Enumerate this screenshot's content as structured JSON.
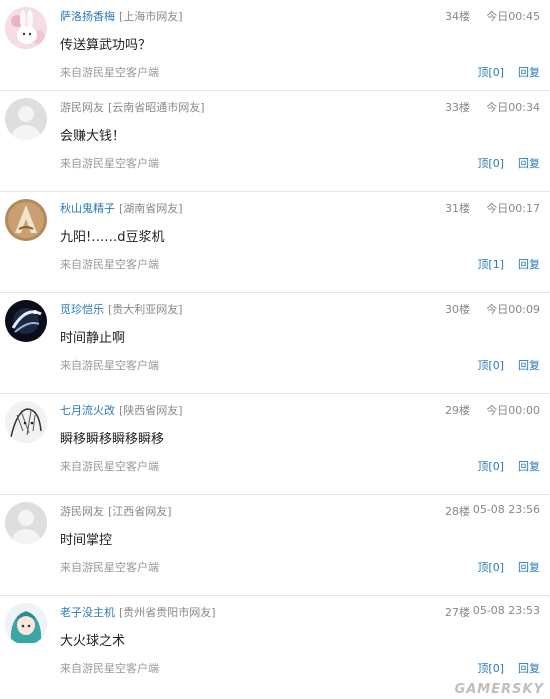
{
  "comments": [
    {
      "user": "萨洛扬香梅",
      "location": "[上海市网友]",
      "floor": "34楼",
      "time": "今日00:45",
      "content": "传送算武功吗？",
      "source": "来自游民星空客户端",
      "like": "顶[0]",
      "reply": "回复",
      "avatar": "rabbit-avatar-icon",
      "guest": false
    },
    {
      "user": "游民网友",
      "location": "[云南省昭通市网友]",
      "floor": "33楼",
      "time": "今日00:34",
      "content": "会赚大钱！",
      "source": "来自游民星空客户端",
      "like": "顶[0]",
      "reply": "回复",
      "avatar": "default-user-avatar-icon",
      "guest": true
    },
    {
      "user": "秋山鬼精子",
      "location": "[湖南省网友]",
      "floor": "31楼",
      "time": "今日00:17",
      "content": "九阳!……d豆浆机",
      "source": "来自游民星空客户端",
      "like": "顶[1]",
      "reply": "回复",
      "avatar": "assassin-emblem-avatar-icon",
      "guest": false
    },
    {
      "user": "觅珍恺乐",
      "location": "[贵大利亚网友]",
      "floor": "30楼",
      "time": "今日00:09",
      "content": "时间静止啊",
      "source": "来自游民星空客户端",
      "like": "顶[0]",
      "reply": "回复",
      "avatar": "space-orb-avatar-icon",
      "guest": false
    },
    {
      "user": "七月流火改",
      "location": "[陕西省网友]",
      "floor": "29楼",
      "time": "今日00:00",
      "content": "瞬移瞬移瞬移瞬移",
      "source": "来自游民星空客户端",
      "like": "顶[0]",
      "reply": "回复",
      "avatar": "sketch-character-avatar-icon",
      "guest": false
    },
    {
      "user": "游民网友",
      "location": "[江西省网友]",
      "floor": "28楼",
      "time": "05-08 23:56",
      "content": "时间掌控",
      "source": "来自游民星空客户端",
      "like": "顶[0]",
      "reply": "回复",
      "avatar": "default-user-avatar-icon",
      "guest": true
    },
    {
      "user": "老子没主机",
      "location": "[贵州省贵阳市网友]",
      "floor": "27楼",
      "time": "05-08 23:53",
      "content": "大火球之术",
      "source": "来自游民星空客户端",
      "like": "顶[0]",
      "reply": "回复",
      "avatar": "anime-girl-avatar-icon",
      "guest": false
    }
  ],
  "watermark": "GAMERSKY"
}
